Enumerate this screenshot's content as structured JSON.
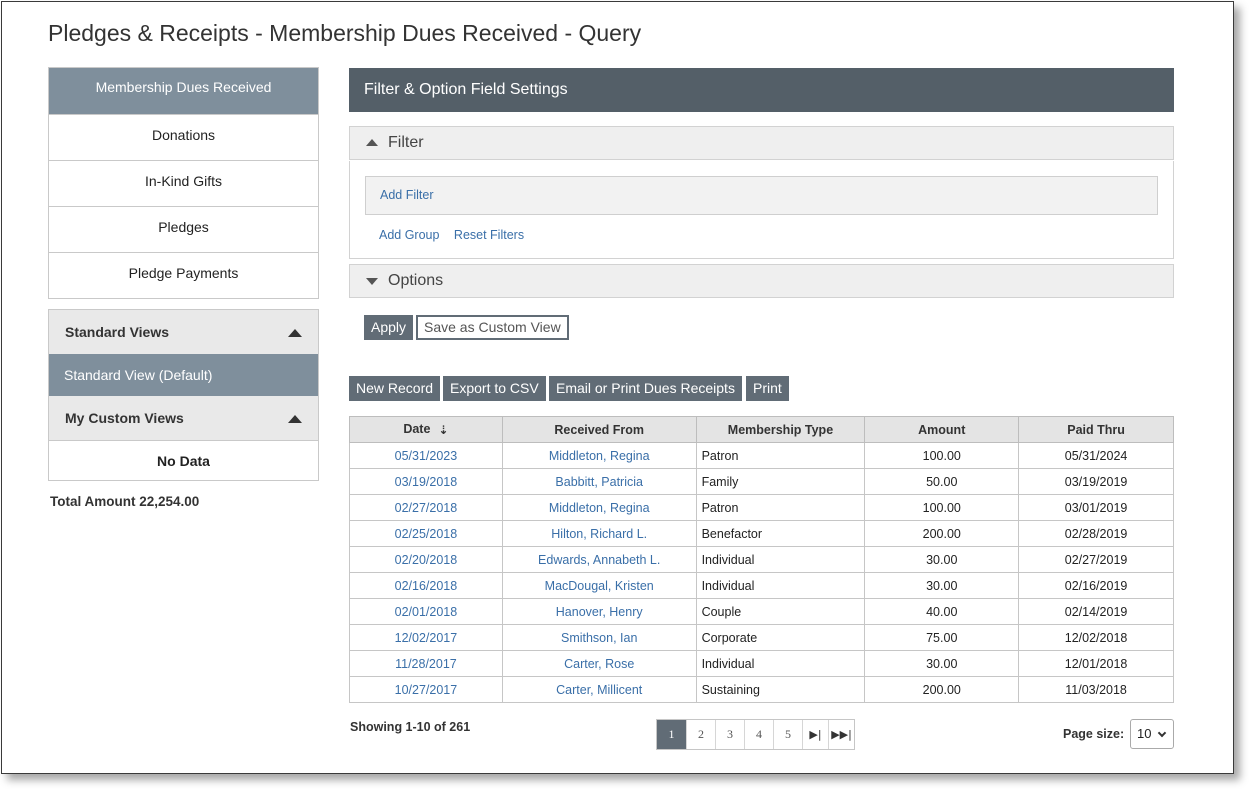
{
  "page": {
    "title": "Pledges & Receipts - Membership Dues Received - Query"
  },
  "sidebar": {
    "items": [
      {
        "label": "Membership Dues Received",
        "active": true
      },
      {
        "label": "Donations"
      },
      {
        "label": "In-Kind Gifts"
      },
      {
        "label": "Pledges"
      },
      {
        "label": "Pledge Payments"
      }
    ],
    "standard_views_label": "Standard Views",
    "standard_view_default": "Standard View (Default)",
    "my_custom_views_label": "My Custom Views",
    "no_data": "No Data",
    "total_amount": "Total Amount 22,254.00"
  },
  "panel": {
    "header": "Filter & Option Field Settings",
    "filter_label": "Filter",
    "add_filter": "Add Filter",
    "add_group": "Add Group",
    "reset_filters": "Reset Filters",
    "options_label": "Options",
    "apply": "Apply",
    "save_custom_view": "Save as Custom View"
  },
  "toolbar": {
    "new_record": "New Record",
    "export_csv": "Export to CSV",
    "email_print": "Email or Print Dues Receipts",
    "print": "Print"
  },
  "table": {
    "columns": [
      "Date",
      "Received From",
      "Membership Type",
      "Amount",
      "Paid Thru"
    ],
    "rows": [
      [
        "05/31/2023",
        "Middleton, Regina",
        "Patron",
        "100.00",
        "05/31/2024"
      ],
      [
        "03/19/2018",
        "Babbitt, Patricia",
        "Family",
        "50.00",
        "03/19/2019"
      ],
      [
        "02/27/2018",
        "Middleton, Regina",
        "Patron",
        "100.00",
        "03/01/2019"
      ],
      [
        "02/25/2018",
        "Hilton, Richard L.",
        "Benefactor",
        "200.00",
        "02/28/2019"
      ],
      [
        "02/20/2018",
        "Edwards, Annabeth L.",
        "Individual",
        "30.00",
        "02/27/2019"
      ],
      [
        "02/16/2018",
        "MacDougal, Kristen",
        "Individual",
        "30.00",
        "02/16/2019"
      ],
      [
        "02/01/2018",
        "Hanover, Henry",
        "Couple",
        "40.00",
        "02/14/2019"
      ],
      [
        "12/02/2017",
        "Smithson, Ian",
        "Corporate",
        "75.00",
        "12/02/2018"
      ],
      [
        "11/28/2017",
        "Carter, Rose",
        "Individual",
        "30.00",
        "12/01/2018"
      ],
      [
        "10/27/2017",
        "Carter, Millicent",
        "Sustaining",
        "200.00",
        "11/03/2018"
      ]
    ]
  },
  "pagination": {
    "showing": "Showing 1-10 of 261",
    "pages": [
      "1",
      "2",
      "3",
      "4",
      "5"
    ],
    "current": "1",
    "next_icon": "next-page-icon",
    "last_icon": "last-page-icon",
    "page_size_label": "Page size:",
    "page_size_value": "10"
  },
  "icons": {
    "sort": "sort-descending-icon",
    "collapse": "triangle-up-icon",
    "expand": "triangle-down-icon"
  },
  "colors": {
    "accent": "#7f8f9c",
    "header_dark": "#545f68",
    "button": "#616c76",
    "link": "#3a6fa8"
  }
}
